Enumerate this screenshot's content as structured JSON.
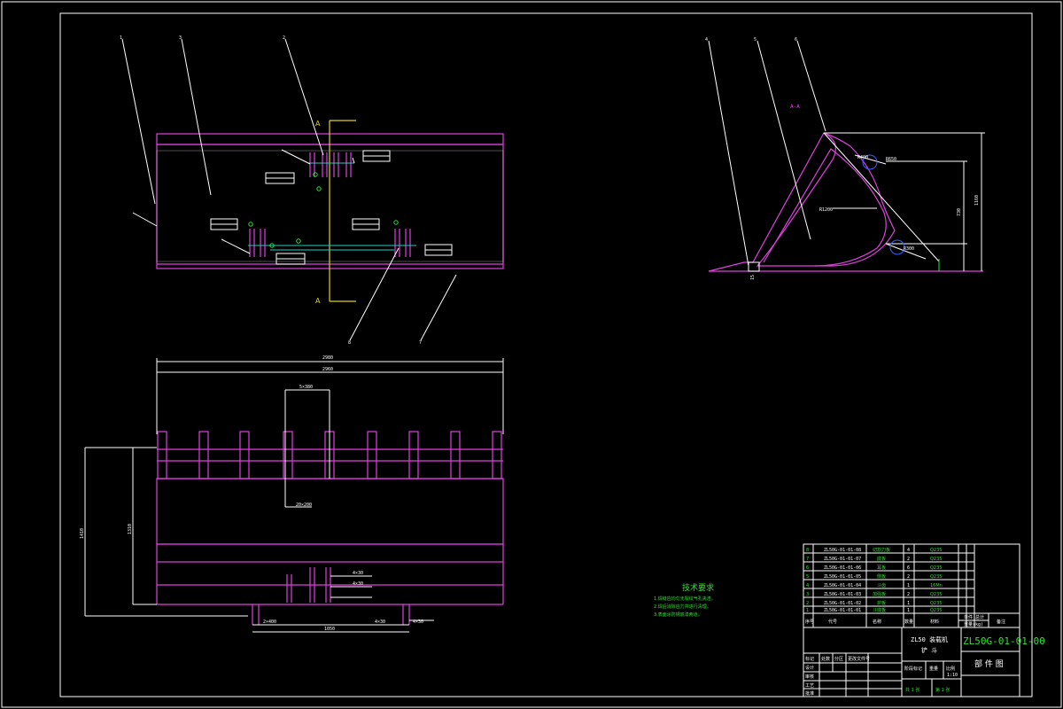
{
  "drawing": {
    "section_label": "A-A",
    "section_mark": "A",
    "balloons_front": [
      "1",
      "3",
      "2",
      "8",
      "7"
    ],
    "balloons_side": [
      "4",
      "5",
      "6"
    ],
    "dims_side": [
      "1160",
      "730",
      "R1200",
      "R650",
      "R400",
      "R300",
      "15"
    ],
    "dims_plan": [
      "2980",
      "2960",
      "5×380",
      "20×200",
      "1410",
      "1310",
      "1050",
      "2×400",
      "4×30"
    ]
  },
  "tech": {
    "title": "技术要求",
    "lines": [
      "1.焊缝应均匀无裂纹气孔夹渣。",
      "2.焊后消除应力并进行清理。",
      "3.表面涂防锈底漆两道。"
    ]
  },
  "bom": {
    "rows": [
      {
        "no": "8",
        "code": "ZL50G-01-01-08",
        "name": "切割刀板",
        "qty": "4",
        "mat": "Q235"
      },
      {
        "no": "7",
        "code": "ZL50G-01-01-07",
        "name": "底板",
        "qty": "2",
        "mat": "Q235"
      },
      {
        "no": "6",
        "code": "ZL50G-01-01-06",
        "name": "耳板",
        "qty": "6",
        "mat": "Q235"
      },
      {
        "no": "5",
        "code": "ZL50G-01-01-05",
        "name": "侧板",
        "qty": "2",
        "mat": "Q235"
      },
      {
        "no": "4",
        "code": "ZL50G-01-01-04",
        "name": "斗齿",
        "qty": "1",
        "mat": "16Mn"
      },
      {
        "no": "3",
        "code": "ZL50G-01-01-03",
        "name": "加强板",
        "qty": "2",
        "mat": "Q235"
      },
      {
        "no": "2",
        "code": "ZL50G-01-01-02",
        "name": "护板",
        "qty": "1",
        "mat": "Q235"
      },
      {
        "no": "1",
        "code": "ZL50G-01-01-01",
        "name": "斗底板",
        "qty": "1",
        "mat": "Q235"
      }
    ],
    "header": {
      "no": "序号",
      "code": "代号",
      "name": "名称",
      "qty": "数量",
      "mat": "材料",
      "weight": "单件 总计",
      "mass": "重量(kg)",
      "note": "备注"
    }
  },
  "titleblock": {
    "project": "ZL50 装载机",
    "part": "铲 斗",
    "drawing_no": "ZL50G-01-01-00",
    "type": "部 件 图",
    "sheets": "共 1 张",
    "sheet": "第 1 张",
    "scale": "1:10",
    "labels": [
      "标记",
      "处数",
      "分区",
      "更改文件号",
      "设计",
      "审核",
      "工艺",
      "批准",
      "阶段标记",
      "重量",
      "比例"
    ]
  }
}
